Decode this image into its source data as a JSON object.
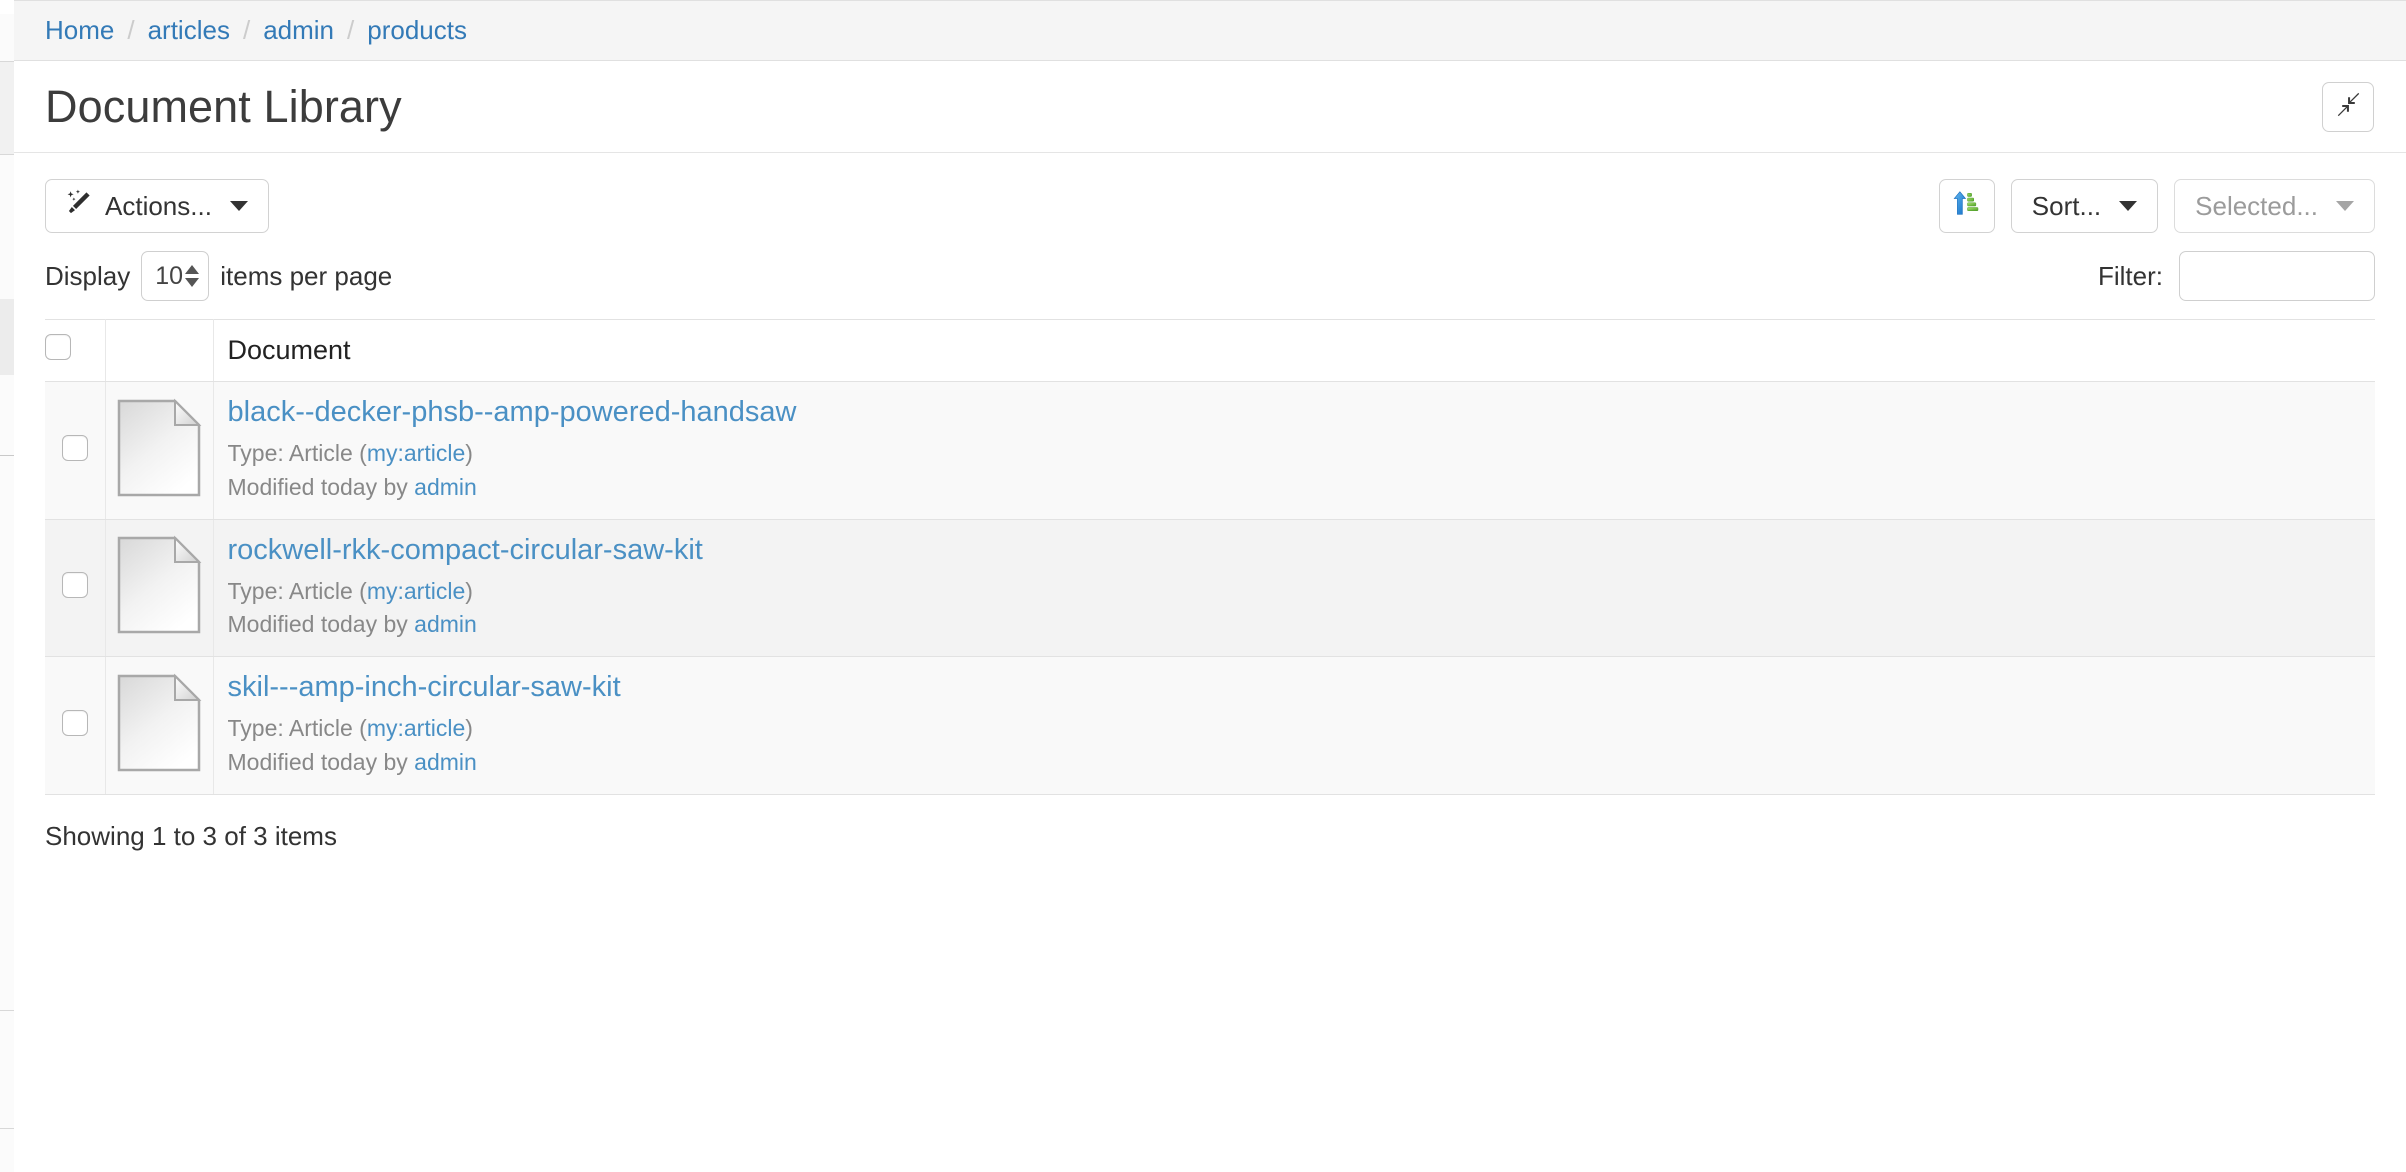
{
  "breadcrumb": {
    "separator": "/",
    "items": [
      {
        "label": "Home"
      },
      {
        "label": "articles"
      },
      {
        "label": "admin"
      },
      {
        "label": "products"
      }
    ]
  },
  "header": {
    "title": "Document Library",
    "collapse_button_icon": "compress-arrows-icon"
  },
  "toolbar": {
    "actions_label": "Actions...",
    "actions_icon": "magic-wand-icon",
    "sort_asc_icon": "sort-ascending-icon",
    "sort_label": "Sort...",
    "selected_label": "Selected..."
  },
  "pagination_controls": {
    "display_label": "Display",
    "page_size_value": "10",
    "items_per_page_label": "items per page"
  },
  "filter": {
    "label": "Filter:",
    "value": "",
    "placeholder": ""
  },
  "table": {
    "headers": {
      "select_all": "",
      "icon": "",
      "document": "Document"
    },
    "rows": [
      {
        "title": "black--decker-phsb--amp-powered-handsaw",
        "type_prefix": "Type: Article (",
        "type_link": "my:article",
        "type_suffix": ")",
        "modified_prefix": "Modified today by ",
        "modified_user": "admin",
        "icon": "document-file-icon"
      },
      {
        "title": "rockwell-rkk-compact-circular-saw-kit",
        "type_prefix": "Type: Article (",
        "type_link": "my:article",
        "type_suffix": ")",
        "modified_prefix": "Modified today by ",
        "modified_user": "admin",
        "icon": "document-file-icon"
      },
      {
        "title": "skil---amp-inch-circular-saw-kit",
        "type_prefix": "Type: Article (",
        "type_link": "my:article",
        "type_suffix": ")",
        "modified_prefix": "Modified today by ",
        "modified_user": "admin",
        "icon": "document-file-icon"
      }
    ]
  },
  "footer": {
    "status": "Showing 1 to 3 of 3 items"
  },
  "colors": {
    "link": "#337ab7",
    "doc_link": "#4a90c4",
    "breadcrumb_bg": "#f5f5f5",
    "row_a": "#f9f9f9",
    "row_b": "#f3f3f3",
    "border": "#e2e2e2",
    "text": "#333333",
    "muted_text": "#888888"
  }
}
